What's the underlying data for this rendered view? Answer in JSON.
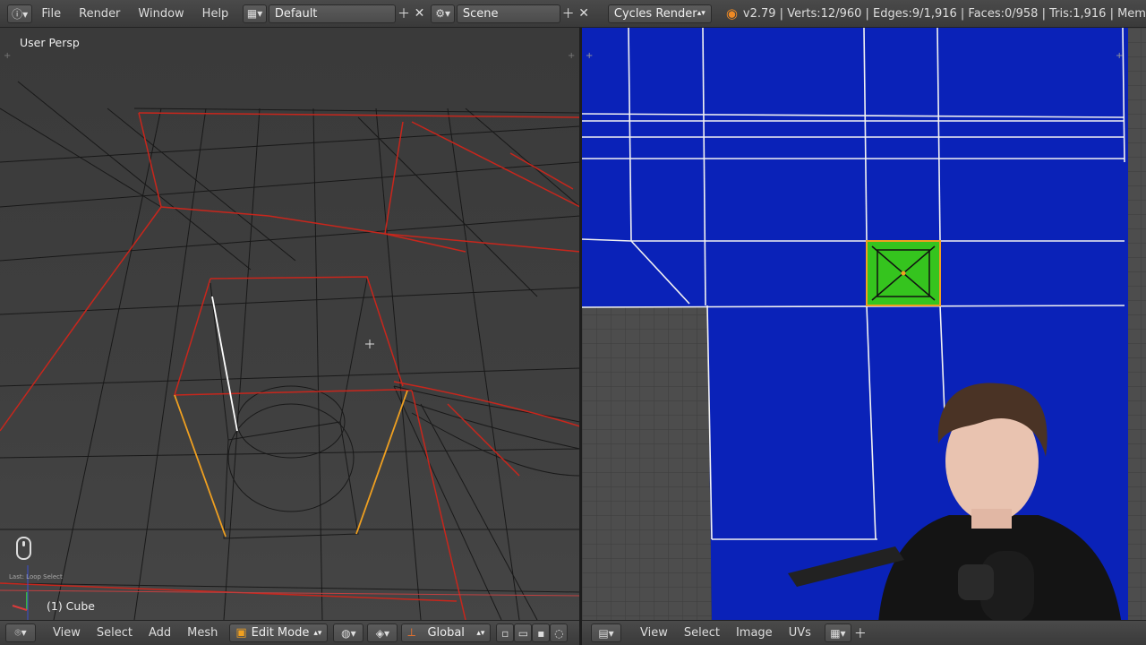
{
  "topbar": {
    "menus": [
      "File",
      "Render",
      "Window",
      "Help"
    ],
    "screen_layout": "Default",
    "scene": "Scene",
    "render_engine": "Cycles Render",
    "stats": "v2.79 | Verts:12/960 | Edges:9/1,916 | Faces:0/958 | Tris:1,916 | Mem"
  },
  "viewport": {
    "view_label": "User Persp",
    "object_label": "(1) Cube",
    "last_operator": "Last: Loop Select"
  },
  "viewport_header": {
    "menus": [
      "View",
      "Select",
      "Add",
      "Mesh"
    ],
    "mode": "Edit Mode",
    "orientation": "Global"
  },
  "uv_header": {
    "menus": [
      "View",
      "Select",
      "Image",
      "UVs"
    ]
  },
  "colors": {
    "uv_blue": "#0a22b8",
    "uv_selected": "#2fcf1a",
    "wire_red": "#d8271f",
    "wire_selected": "#f0a020",
    "header": "#444444"
  }
}
